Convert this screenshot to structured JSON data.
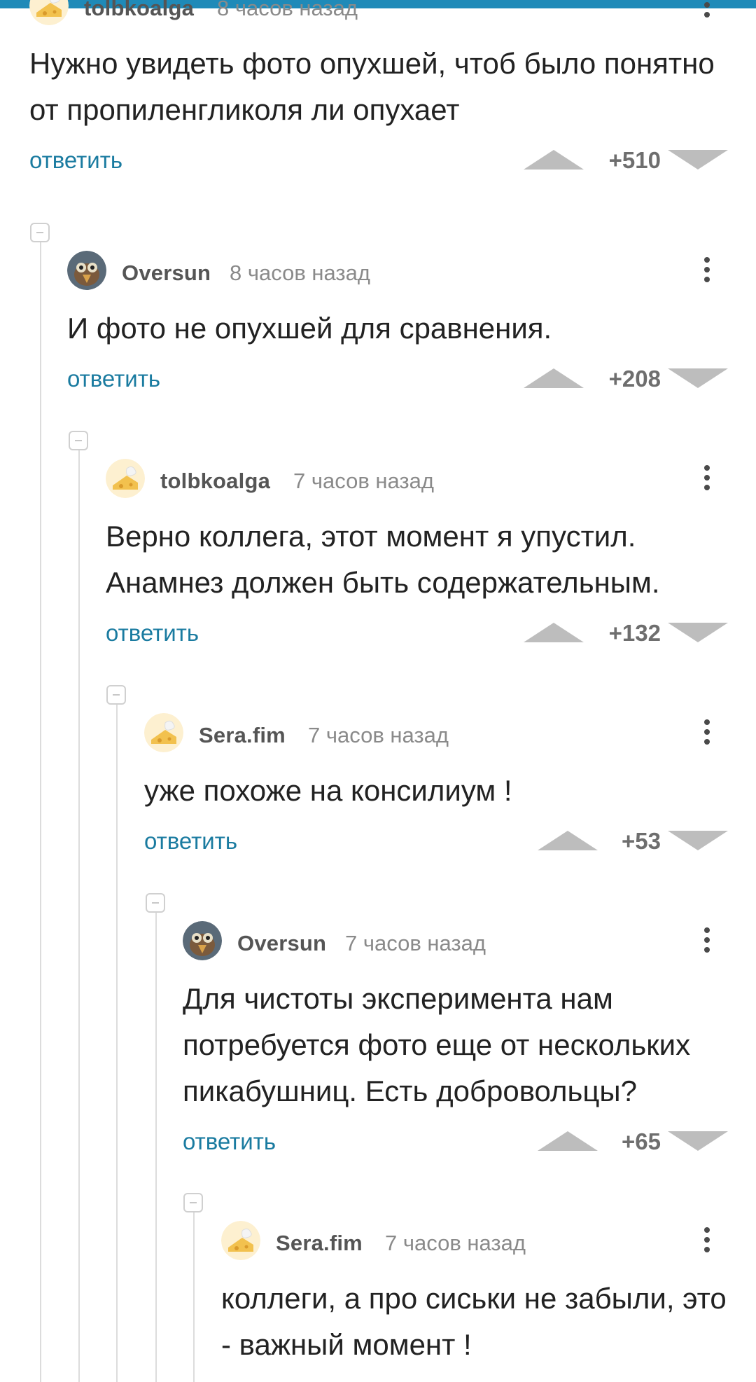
{
  "comments": [
    {
      "author": "tolbkoalga",
      "time": "8 часов назад",
      "avatar": "cheese-avatar",
      "text": "Нужно увидеть фото опухшей, чтоб было понятно от пропиленгликоля ли опухает",
      "reply_label": "ответить",
      "score": "+510",
      "level": 0
    },
    {
      "author": "Oversun",
      "time": "8 часов назад",
      "avatar": "bird-avatar",
      "text": "И фото не опухшей для сравнения.",
      "reply_label": "ответить",
      "score": "+208",
      "level": 1
    },
    {
      "author": "tolbkoalga",
      "time": "7 часов назад",
      "avatar": "cheese-avatar",
      "text": "Верно коллега, этот момент я упустил. Анамнез должен быть содержательным.",
      "reply_label": "ответить",
      "score": "+132",
      "level": 2
    },
    {
      "author": "Sera.fim",
      "time": "7 часов назад",
      "avatar": "cheese-avatar",
      "text": "уже похоже на консилиум !",
      "reply_label": "ответить",
      "score": "+53",
      "level": 3
    },
    {
      "author": "Oversun",
      "time": "7 часов назад",
      "avatar": "bird-avatar",
      "text": "Для чистоты эксперимента нам потребуется фото еще от нескольких пикабушниц. Есть добровольцы?",
      "reply_label": "ответить",
      "score": "+65",
      "level": 4
    },
    {
      "author": "Sera.fim",
      "time": "7 часов назад",
      "avatar": "cheese-avatar",
      "text": "коллеги, а про сиськи не забыли, это - важный момент !",
      "reply_label": "",
      "score": "",
      "level": 5
    }
  ],
  "colors": {
    "accent": "#1a7ba0",
    "top_bar": "#1f8ab8",
    "author": "#555555",
    "time": "#8a8a8a",
    "vote_arrow": "#bdbdbd"
  },
  "icons": {
    "vote_up": "triangle-up-icon",
    "vote_down": "triangle-down-icon",
    "more": "more-vertical-icon",
    "collapse": "collapse-minus-icon"
  }
}
